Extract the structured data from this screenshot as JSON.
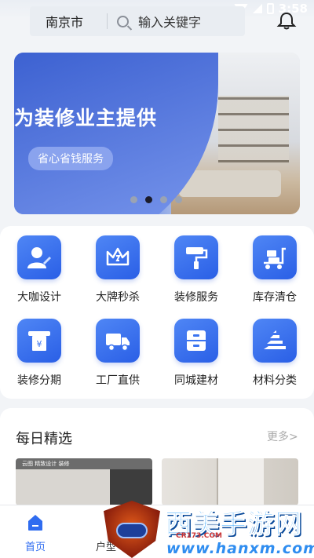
{
  "status_bar": {
    "time": "3:58"
  },
  "header": {
    "city": "南京市",
    "search_placeholder": "输入关键字"
  },
  "banner": {
    "headline": "为装修业主提供",
    "pill": "省心省钱服务",
    "page_count": 4,
    "active_page": 1
  },
  "categories": [
    {
      "label": "大咖设计",
      "icon": "designer-icon"
    },
    {
      "label": "大牌秒杀",
      "icon": "crown-icon"
    },
    {
      "label": "装修服务",
      "icon": "paint-roller-icon"
    },
    {
      "label": "库存清仓",
      "icon": "cart-icon"
    },
    {
      "label": "装修分期",
      "icon": "installment-icon"
    },
    {
      "label": "工厂直供",
      "icon": "truck-icon"
    },
    {
      "label": "同城建材",
      "icon": "cabinet-icon"
    },
    {
      "label": "材料分类",
      "icon": "layers-icon"
    }
  ],
  "daily": {
    "title": "每日精选",
    "more": "更多>",
    "pick1_tag": "云图 精致设计 装修"
  },
  "tabbar": {
    "tabs": [
      {
        "label": "首页",
        "icon": "home-icon",
        "active": true
      },
      {
        "label": "户型"
      }
    ]
  },
  "watermark": {
    "name": "西美手游网",
    "url": "www.hanxm.com",
    "small": "CR173.COM"
  },
  "colors": {
    "accent": "#2f6cf0",
    "tile": "#3b74f0"
  }
}
